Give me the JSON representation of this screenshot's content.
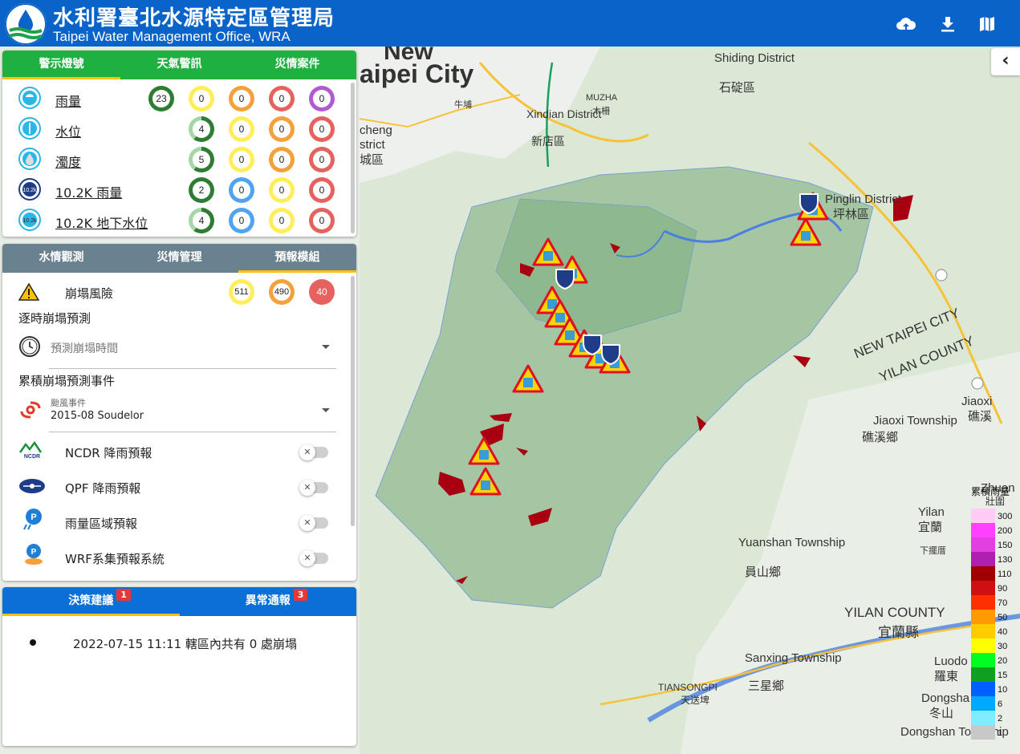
{
  "header": {
    "title_zh": "水利署臺北水源特定區管理局",
    "title_en": "Taipei Water Management Office, WRA",
    "icons": [
      "cloud-upload-icon",
      "download-icon",
      "map-icon"
    ]
  },
  "alerts_panel": {
    "tabs": [
      {
        "label": "警示燈號",
        "active": true
      },
      {
        "label": "天氣警訊",
        "active": false
      },
      {
        "label": "災情案件",
        "active": false
      }
    ],
    "rows": [
      {
        "label": "雨量",
        "icon": "rain-icon",
        "counts": [
          "23",
          "0",
          "0",
          "0",
          "0"
        ]
      },
      {
        "label": "水位",
        "icon": "water-level-icon",
        "counts": [
          "4",
          "0",
          "0",
          "0"
        ]
      },
      {
        "label": "濁度",
        "icon": "turbidity-icon",
        "counts": [
          "5",
          "0",
          "0",
          "0"
        ]
      },
      {
        "label": "10.2K 雨量",
        "icon": "10-2k-rain-icon",
        "counts": [
          "2",
          "0",
          "0",
          "0"
        ]
      },
      {
        "label": "10.2K 地下水位",
        "icon": "10-2k-groundwater-icon",
        "counts": [
          "4",
          "0",
          "0",
          "0"
        ]
      }
    ],
    "colors": {
      "tab_bg": "#1fb140",
      "green": "#2e7d32",
      "yellow": "#ffee58",
      "orange": "#f5a13b",
      "red": "#e5625f",
      "purple": "#b15bd1",
      "blue": "#4fa3f0"
    }
  },
  "forecast_panel": {
    "tabs": [
      {
        "label": "水情觀測",
        "active": false
      },
      {
        "label": "災情管理",
        "active": false
      },
      {
        "label": "預報模組",
        "active": true
      }
    ],
    "collapse": {
      "label": "崩塌風險",
      "counts": [
        "511",
        "490",
        "40"
      ]
    },
    "realtime_title": "逐時崩塌預測",
    "time_select_placeholder": "預測崩塌時間",
    "cumulative_title": "累積崩塌預測事件",
    "event_select": {
      "caption": "颱風事件",
      "value": "2015-08 Soudelor"
    },
    "toggles": [
      {
        "label": "NCDR 降雨預報",
        "icon": "ncdr-icon",
        "on": false
      },
      {
        "label": "QPF 降雨預報",
        "icon": "qpf-icon",
        "on": false
      },
      {
        "label": "雨量區域預報",
        "icon": "regional-rain-icon",
        "on": false
      },
      {
        "label": "WRF系集預報系統",
        "icon": "wrf-icon",
        "on": false
      }
    ],
    "switch_off_glyph": "✕"
  },
  "decision_panel": {
    "tabs": [
      {
        "label": "決策建議",
        "badge": "1",
        "active": true
      },
      {
        "label": "異常通報",
        "badge": "3",
        "active": false
      }
    ],
    "items": [
      {
        "text": "2022-07-15 11:11 轄區內共有 0 處崩塌"
      }
    ]
  },
  "map": {
    "collapse_button_glyph": "‹",
    "labels": [
      "aipei City",
      "New",
      "Shiding District",
      "石碇區",
      "Xindian District",
      "新店區",
      "MUZHA",
      "木柵",
      "Pinglin District",
      "坪林區",
      "NEW TAIPEI CITY",
      "YILAN COUNTY",
      "Jiaoxi",
      "礁溪",
      "Jiaoxi Township",
      "礁溪鄉",
      "Yuanshan Township",
      "員山鄉",
      "Yilan",
      "宜蘭",
      "YILAN COUNTY",
      "宜蘭縣",
      "Sanxing Township",
      "三星鄉",
      "TIANSONGPI",
      "天送埤",
      "Luodo",
      "羅東",
      "Dongsha",
      "冬山",
      "Dongshan Township",
      "Zhuan",
      "壯圍",
      "下擺厝",
      "cheng",
      "strict",
      "城區",
      "牛埔"
    ],
    "legend": {
      "unit": "累積雨量",
      "levels": [
        "300",
        "200",
        "150",
        "130",
        "110",
        "90",
        "70",
        "50",
        "40",
        "30",
        "20",
        "15",
        "10",
        "6",
        "2",
        "1"
      ],
      "colors": [
        "#ffccf5",
        "#ff40ff",
        "#e040e0",
        "#b020b0",
        "#a00000",
        "#d01010",
        "#ff3000",
        "#ff9a00",
        "#ffcc00",
        "#ffff00",
        "#00ff20",
        "#10a020",
        "#0060ff",
        "#00a8ff",
        "#80ecff",
        "#c8c8c8"
      ]
    }
  }
}
